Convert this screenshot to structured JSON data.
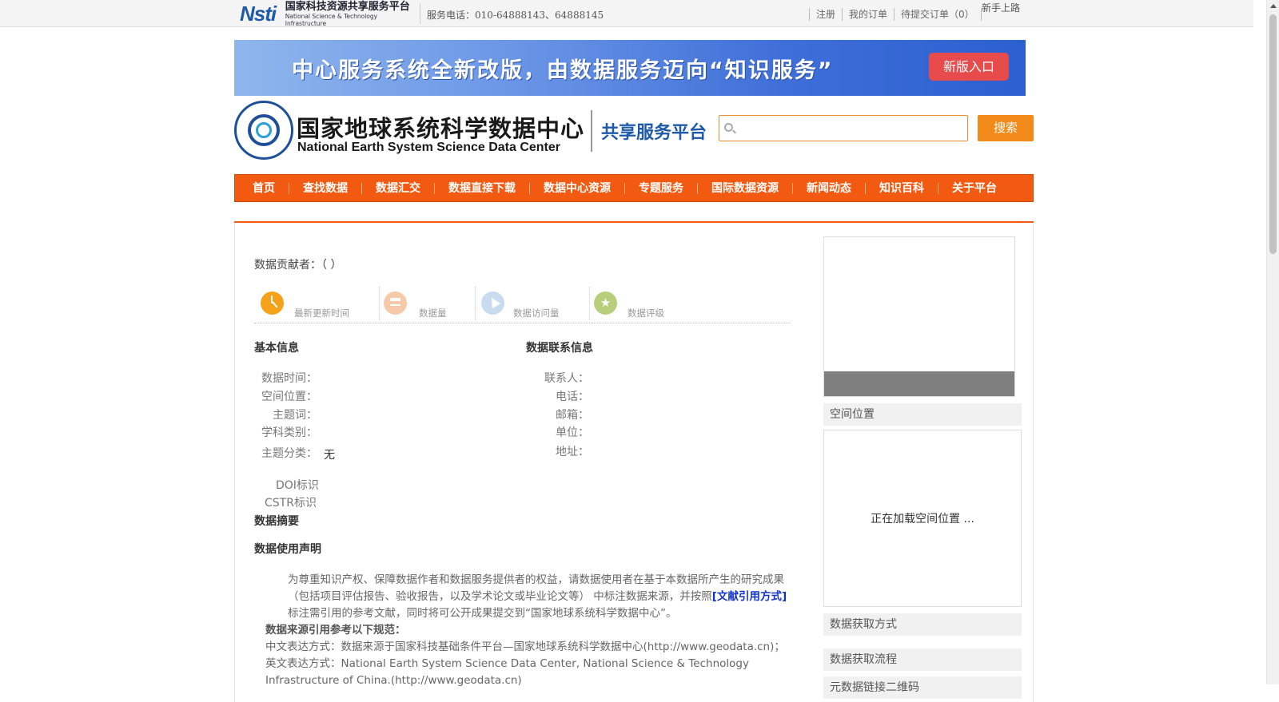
{
  "topbar": {
    "platform_cn": "国家科技资源共享服务平台",
    "platform_en": "National Science & Technology Infrastructure",
    "logo_mark": "Nsti",
    "phone": "服务电话：010-64888143、64888145",
    "links": [
      "注册",
      "我的订单",
      "待提交订单（0）"
    ],
    "novice": "新手上路"
  },
  "banner": {
    "text": "中心服务系统全新改版，由数据服务迈向“知识服务”",
    "button": "新版入口"
  },
  "header": {
    "title_cn": "国家地球系统科学数据中心",
    "title_en": "National Earth System Science Data Center",
    "platform": "共享服务平台",
    "search_placeholder": "",
    "search_button": "搜索"
  },
  "nav": [
    "首页",
    "查找数据",
    "数据汇交",
    "数据直接下载",
    "数据中心资源",
    "专题服务",
    "国际数据资源",
    "新闻动态",
    "知识百科",
    "关于平台"
  ],
  "detail": {
    "contributor": "数据贡献者：（ ）",
    "stats": [
      {
        "label": "最新更新时间",
        "icon": "clock-icon",
        "color": "#f5a21a"
      },
      {
        "label": "数据量",
        "icon": "layers-icon",
        "color": "#f6c9a8"
      },
      {
        "label": "数据访问量",
        "icon": "cursor-icon",
        "color": "#c8dcef"
      },
      {
        "label": "数据评级",
        "icon": "star-icon",
        "color": "#b7cf7a"
      }
    ],
    "basic_title": "基本信息",
    "basic_fields": [
      "数据时间：",
      "空间位置：",
      "主题词：",
      "学科类别：",
      "主题分类："
    ],
    "topic_value": "无",
    "doi_label": "DOI标识",
    "cstr_label": "CSTR标识",
    "contact_title": "数据联系信息",
    "contact_fields": [
      "联系人：",
      "电话：",
      "邮箱：",
      "单位：",
      "地址："
    ],
    "abstract_title": "数据摘要",
    "usage_title": "数据使用声明",
    "usage_text_1": "为尊重知识产权、保障数据作者和数据服务提供者的权益，请数据使用者在基于本数据所产生的研究成果（包括项目评估报告、验收报告，以及学术论文或毕业论文等） 中标注数据来源，并按照",
    "usage_link": "[文献引用方式]",
    "usage_text_2": "标注需引用的参考文献，同时将可公开成果提交到“国家地球系统科学数据中心”。",
    "cite_title": "数据来源引用参考以下规范：",
    "cite_cn": "中文表达方式：数据来源于国家科技基础条件平台—国家地球系统科学数据中心(http://www.geodata.cn)；",
    "cite_en": "英文表达方式：National Earth System Science Data Center, National Science & Technology Infrastructure of China.(http://www.geodata.cn)"
  },
  "side": {
    "spatial": "空间位置",
    "loading": "正在加载空间位置 ...",
    "access": "数据获取方式",
    "flow": "数据获取流程",
    "qrcode": "元数据链接二维码"
  }
}
